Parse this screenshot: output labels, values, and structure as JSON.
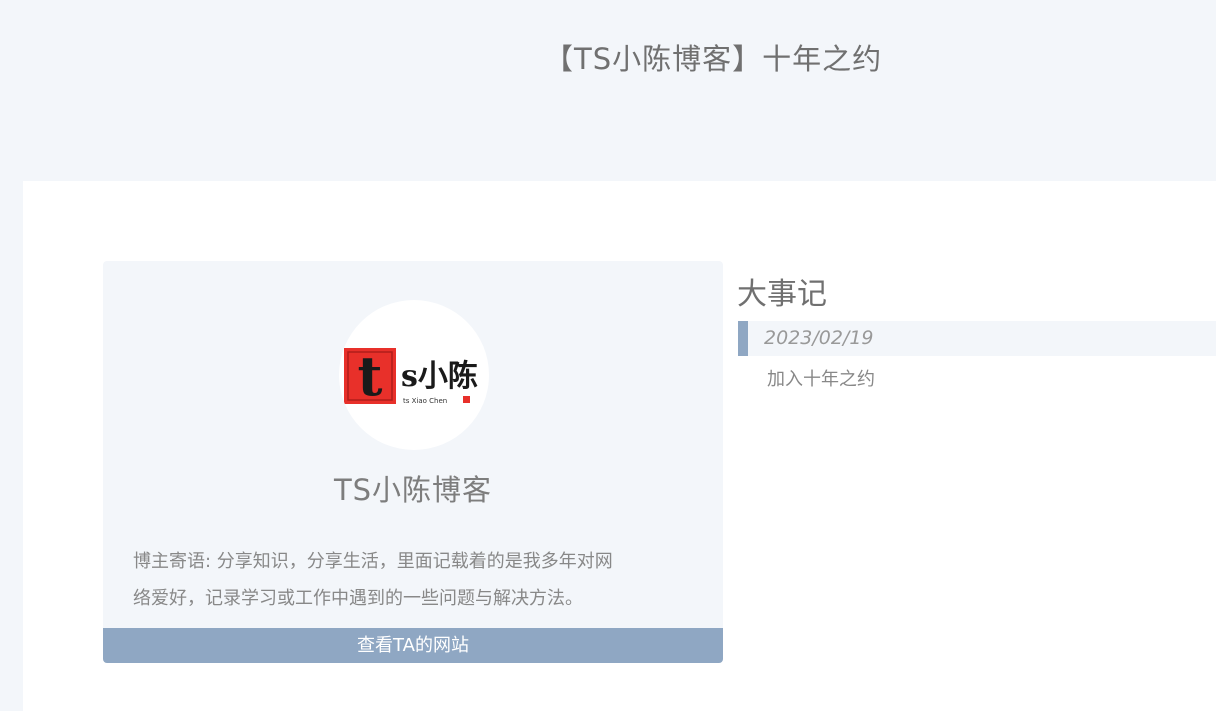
{
  "page": {
    "title": "【TS小陈博客】十年之约"
  },
  "profile": {
    "name": "TS小陈博客",
    "motto_line1": "博主寄语: 分享知识，分享生活，里面记载着的是我多年对网",
    "motto_line2": "络爱好，记录学习或工作中遇到的一些问题与解决方法。",
    "visit_label": "查看TA的网站",
    "logo": {
      "big_letter": "t",
      "text": "s小陈",
      "subtitle": "ts Xiao Chen"
    }
  },
  "events": {
    "heading": "大事记",
    "items": [
      {
        "date": "2023/02/19",
        "description": "加入十年之约"
      }
    ]
  },
  "colors": {
    "background": "#f3f6fa",
    "content": "#ffffff",
    "accent": "#8fa7c3",
    "logo_red": "#e8302a"
  }
}
